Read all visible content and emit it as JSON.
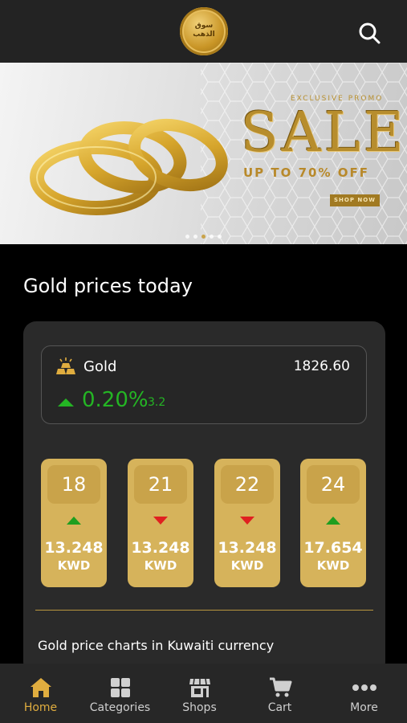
{
  "header": {
    "logo_text_line1": "سوق",
    "logo_text_line2": "الذهب",
    "search_icon": "search-icon"
  },
  "banner": {
    "tagline": "EXCLUSIVE PROMO",
    "headline": "SALE",
    "subline": "UP TO 70% OFF",
    "cta": "SHOP NOW",
    "dots": 5,
    "active_dot": 2
  },
  "section": {
    "title": "Gold prices today"
  },
  "gold": {
    "label": "Gold",
    "price": "1826.60",
    "percent": "0.20%",
    "change": "3.2",
    "trend": "up"
  },
  "karats": [
    {
      "karat": "18",
      "trend": "up",
      "value": "13.248",
      "currency": "KWD"
    },
    {
      "karat": "21",
      "trend": "down",
      "value": "13.248",
      "currency": "KWD"
    },
    {
      "karat": "22",
      "trend": "down",
      "value": "13.248",
      "currency": "KWD"
    },
    {
      "karat": "24",
      "trend": "up",
      "value": "17.654",
      "currency": "KWD"
    }
  ],
  "charts": {
    "title": "Gold price charts in Kuwaiti currency"
  },
  "tabs": [
    {
      "label": "Home",
      "icon": "home-icon",
      "active": true
    },
    {
      "label": "Categories",
      "icon": "categories-icon",
      "active": false
    },
    {
      "label": "Shops",
      "icon": "shops-icon",
      "active": false
    },
    {
      "label": "Cart",
      "icon": "cart-icon",
      "active": false
    },
    {
      "label": "More",
      "icon": "more-icon",
      "active": false
    }
  ],
  "colors": {
    "accent": "#e0ad3f",
    "gold_card": "#d6b35b",
    "up": "#24b524",
    "down": "#e02020",
    "background": "#000000"
  }
}
